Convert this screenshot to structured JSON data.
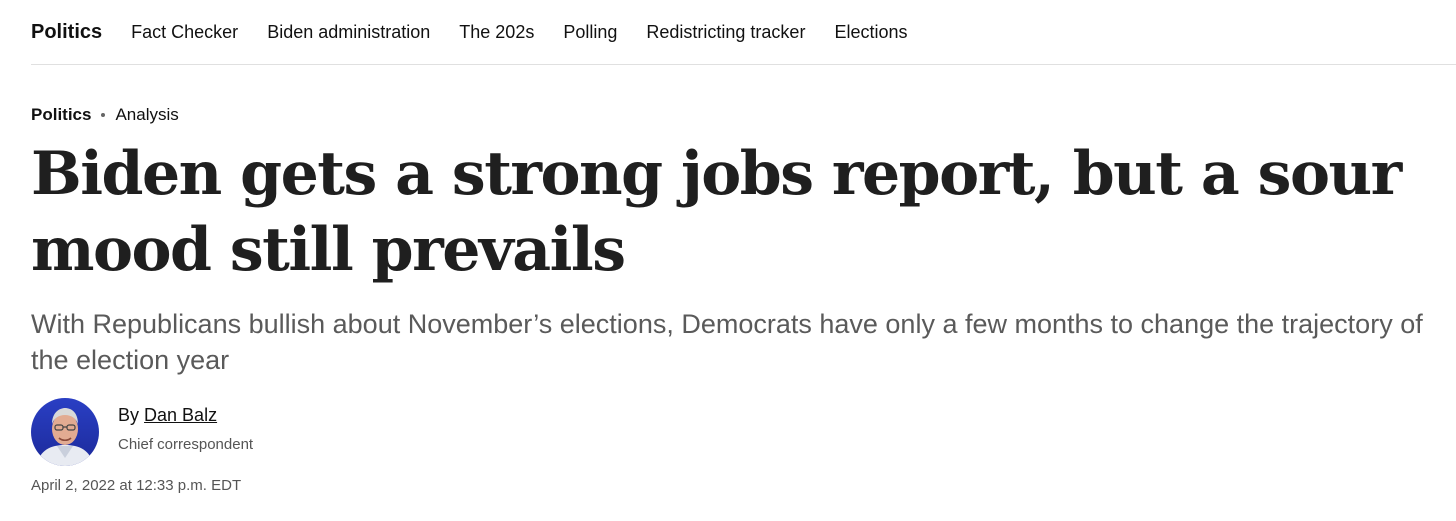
{
  "nav": {
    "section": "Politics",
    "items": [
      {
        "label": "Fact Checker"
      },
      {
        "label": "Biden administration"
      },
      {
        "label": "The 202s"
      },
      {
        "label": "Polling"
      },
      {
        "label": "Redistricting tracker"
      },
      {
        "label": "Elections"
      }
    ]
  },
  "article": {
    "kicker": {
      "section": "Politics",
      "label": "Analysis"
    },
    "headline": "Biden gets a strong jobs report, but a sour mood still prevails",
    "subheadline": "With Republicans bullish about November’s elections, Democrats have only a few months to change the trajectory of the election year",
    "byline": {
      "prefix": "By",
      "author": "Dan Balz",
      "role": "Chief correspondent"
    },
    "date": "April 2, 2022 at 12:33 p.m. EDT"
  },
  "colors": {
    "headline": "#1f1f1f",
    "subheadline": "#5a5a5a",
    "meta": "#555555",
    "divider": "#e0e0e0"
  }
}
